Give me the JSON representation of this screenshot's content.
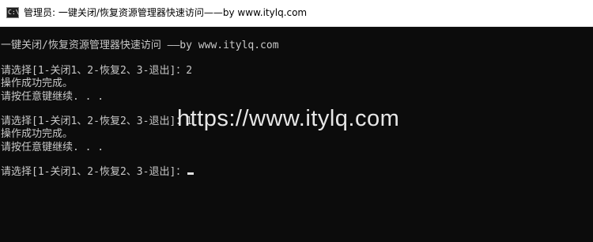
{
  "window": {
    "title": "管理员:  一键关闭/恢复资源管理器快速访问——by www.itylq.com",
    "icon": "cmd-console-icon",
    "icon_glyph": "C:\\"
  },
  "console": {
    "lines": [
      "一键关闭/恢复资源管理器快速访问 ——by www.itylq.com",
      "请选择[1-关闭1、2-恢复2、3-退出]：2",
      "操作成功完成。",
      "请按任意键继续. . .",
      "请选择[1-关闭1、2-恢复2、3-退出]：1",
      "操作成功完成。",
      "请按任意键继续. . .",
      "请选择[1-关闭1、2-恢复2、3-退出]："
    ]
  },
  "watermark": "https://www.itylq.com",
  "colors": {
    "console_bg": "#0c0c0c",
    "console_text": "#c8c8c8",
    "titlebar_bg": "#ffffff"
  }
}
